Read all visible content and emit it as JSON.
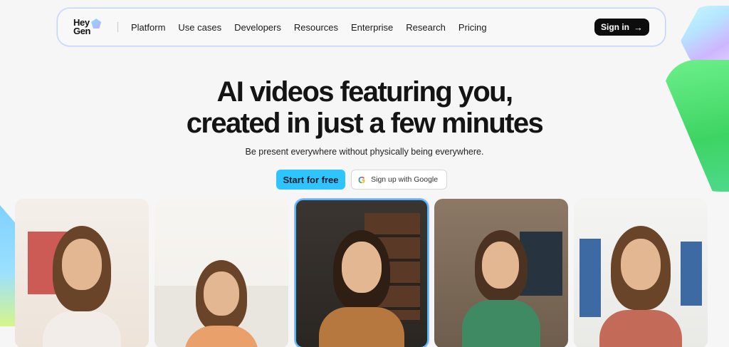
{
  "brand": {
    "line1": "Hey",
    "line2": "Gen"
  },
  "nav": {
    "items": [
      "Platform",
      "Use cases",
      "Developers",
      "Resources",
      "Enterprise",
      "Research",
      "Pricing"
    ],
    "signin_label": "Sign in",
    "signin_icon": "arrow-right-icon"
  },
  "hero": {
    "title_line1": "AI videos featuring you,",
    "title_line2": "created in just a few minutes",
    "subtitle": "Be present everywhere without physically being everywhere.",
    "cta_primary": "Start for free",
    "cta_google": "Sign up with Google",
    "google_icon": "google-icon"
  },
  "colors": {
    "accent_cyan": "#2ec5ff",
    "signin_bg": "#0d0d0d",
    "nav_border": "#b4d8ff",
    "green_blob": "#3ed463"
  },
  "cards": [
    {
      "id": "avatar-video-1"
    },
    {
      "id": "avatar-video-2"
    },
    {
      "id": "avatar-video-3",
      "selected": true
    },
    {
      "id": "avatar-video-4"
    },
    {
      "id": "avatar-video-5"
    }
  ]
}
